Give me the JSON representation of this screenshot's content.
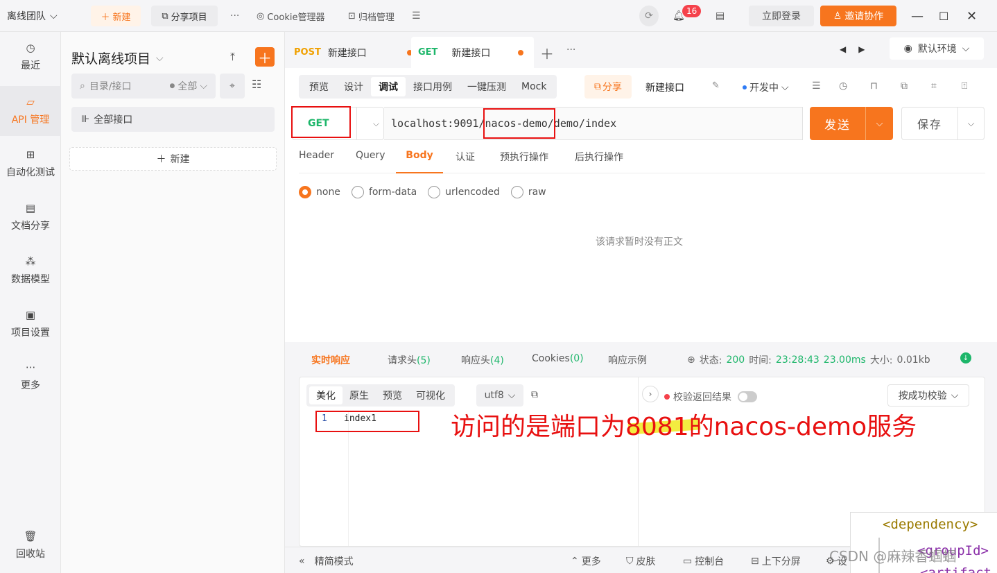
{
  "topbar": {
    "team": "离线团队",
    "new_btn": "新建",
    "share_btn": "分享项目",
    "more": "···",
    "cookie_manager": "Cookie管理器",
    "archive": "归档管理",
    "notifications_count": "16",
    "login": "立即登录",
    "invite": "邀请协作"
  },
  "leftnav": {
    "items": [
      {
        "label": "最近",
        "icon": "clock-icon"
      },
      {
        "label": "API 管理",
        "icon": "api-icon"
      },
      {
        "label": "自动化测试",
        "icon": "automation-icon"
      },
      {
        "label": "文档分享",
        "icon": "doc-icon"
      },
      {
        "label": "数据模型",
        "icon": "model-icon"
      },
      {
        "label": "项目设置",
        "icon": "settings-icon"
      },
      {
        "label": "更多",
        "icon": "more-icon"
      },
      {
        "label": "回收站",
        "icon": "trash-icon"
      }
    ]
  },
  "sidebar": {
    "project_title": "默认离线项目",
    "search_placeholder": "目录/接口",
    "filter": "全部",
    "all_apis": "全部接口",
    "new": "新建"
  },
  "tabs": [
    {
      "method": "POST",
      "name": "新建接口"
    },
    {
      "method": "GET",
      "name": "新建接口"
    }
  ],
  "environment": "默认环境",
  "mode_tabs": [
    "预览",
    "设计",
    "调试",
    "接口用例",
    "一键压测",
    "Mock"
  ],
  "toolbar": {
    "share": "分享",
    "api_name": "新建接口",
    "status": "开发中"
  },
  "request": {
    "method": "GET",
    "url": "localhost:9091/nacos-demo/demo/index",
    "send": "发送",
    "save": "保存"
  },
  "req_tabs": [
    "Header",
    "Query",
    "Body",
    "认证",
    "预执行操作",
    "后执行操作"
  ],
  "body_types": [
    "none",
    "form-data",
    "urlencoded",
    "raw"
  ],
  "empty_body": "该请求暂时没有正文",
  "response": {
    "tabs": {
      "live": "实时响应",
      "req_headers": "请求头",
      "req_headers_count": "(5)",
      "resp_headers": "响应头",
      "resp_headers_count": "(4)",
      "cookies": "Cookies",
      "cookies_count": "(0)",
      "example": "响应示例"
    },
    "status_label": "状态:",
    "status": "200",
    "time_label": "时间:",
    "time": "23:28:43",
    "duration": "23.00ms",
    "size_label": "大小:",
    "size": "0.01kb",
    "format_tabs": [
      "美化",
      "原生",
      "预览",
      "可视化"
    ],
    "encoding": "utf8",
    "validate": "校验返回结果",
    "verify_mode": "按成功校验",
    "body_lines": [
      {
        "num": "1",
        "text": "index1"
      }
    ]
  },
  "annotation": "访问的是端口为8081的nacos-demo服务",
  "footer": {
    "compact": "精简模式",
    "more": "更多",
    "skin": "皮肤",
    "console": "控制台",
    "layout": "上下分屏",
    "settings": "设"
  },
  "overlay_code": {
    "line1": "<dependency>",
    "line2": "<groupId>",
    "line3": "<artifact"
  },
  "watermark": "CSDN @麻辣香蝈蝈"
}
